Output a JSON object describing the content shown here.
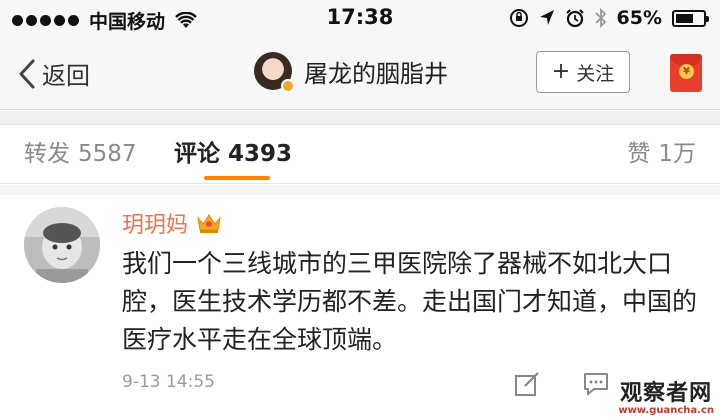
{
  "status_bar": {
    "carrier": "中国移动",
    "time": "17:38",
    "battery_percent_text": "65%",
    "battery_level": 0.65,
    "icons": [
      "signal-dots-icon",
      "wifi-icon",
      "orientation-lock-icon",
      "location-icon",
      "alarm-icon",
      "bluetooth-icon",
      "battery-icon"
    ]
  },
  "nav": {
    "back_label": "返回",
    "title": "屠龙的胭脂井",
    "follow_label": "关注",
    "icons": [
      "chevron-left-icon",
      "verified-badge-icon",
      "plus-icon",
      "red-envelope-icon"
    ]
  },
  "tabs": {
    "repost_label": "转发",
    "repost_count": "5587",
    "comment_label": "评论",
    "comment_count": "4393",
    "like_label": "赞",
    "like_count": "1万"
  },
  "comment": {
    "author": "玥玥妈",
    "text": "我们一个三线城市的三甲医院除了器械不如北大口腔，医生技术学历都不差。走出国门才知道，中国的医疗水平走在全球顶端。",
    "time": "9-13 14:55",
    "icons": [
      "crown-badge-icon",
      "edit-icon",
      "comment-icon"
    ]
  },
  "watermark": {
    "main": "观察者网",
    "sub": "www.guancha.cn"
  },
  "colors": {
    "accent": "#ff8200",
    "author_name": "#eb7350",
    "secondary_text": "#8a8a8a"
  }
}
